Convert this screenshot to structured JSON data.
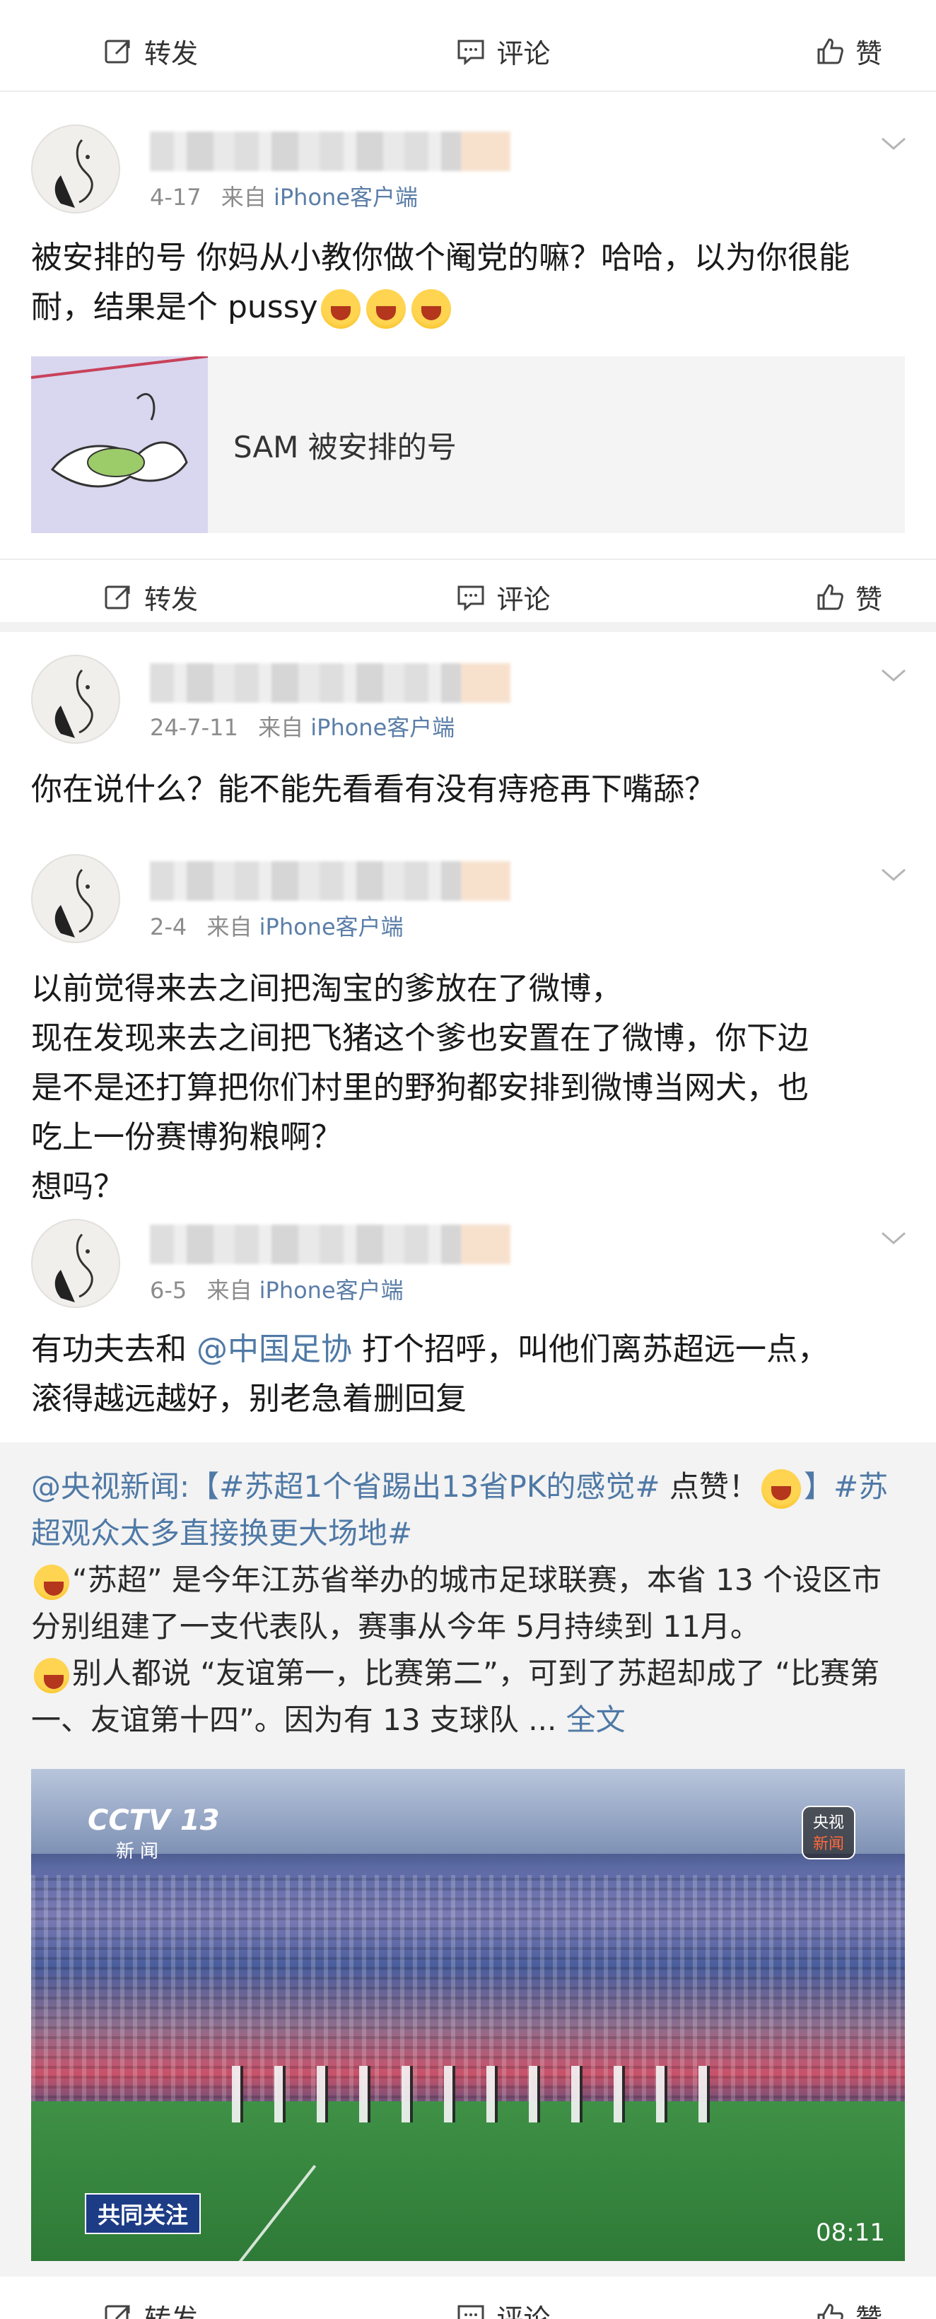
{
  "actions": {
    "repost_label": "转发",
    "comment_label": "评论",
    "like_label": "赞"
  },
  "comments": [
    {
      "date": "4-17",
      "from_prefix": "来自",
      "source": "iPhone客户端",
      "text": "被安排的号 你妈从小教你做个阉党的嘛？哈哈，以为你很能耐，结果是个 pussy",
      "share_card_label": "SAM 被安排的号"
    },
    {
      "date": "24-7-11",
      "from_prefix": "来自",
      "source": "iPhone客户端",
      "text": "你在说什么？能不能先看看有没有痔疮再下嘴舔？"
    },
    {
      "date": "2-4",
      "from_prefix": "来自",
      "source": "iPhone客户端",
      "lines": [
        "以前觉得来去之间把淘宝的爹放在了微博，",
        "现在发现来去之间把飞猪这个爹也安置在了微博，你下边",
        "是不是还打算把你们村里的野狗都安排到微博当网犬，也",
        "吃上一份赛博狗粮啊？",
        "想吗？"
      ]
    },
    {
      "date": "6-5",
      "from_prefix": "来自",
      "source": "iPhone客户端",
      "text_a": "有功夫去和 ",
      "mention": "@中国足协",
      "text_b": " 打个招呼，叫他们离苏超远一点，",
      "text_c": "滚得越远越好，别老急着删回复"
    }
  ],
  "repost": {
    "author": "@央视新闻:",
    "topic1": "【#苏超1个省踢出13省PK的感觉#",
    "text_after_topic1": " 点赞！",
    "topic2": "】#苏超观众太多直接换更大场地#",
    "para1": "“苏超” 是今年江苏省举办的城市足球联赛，本省 13 个设区市分别组建了一支代表队，赛事从今年 5月持续到 11月。",
    "para2": "别人都说 “友谊第一，比赛第二”，可到了苏超却成了 “比赛第一、友谊第十四”。因为有 13 支球队 ...",
    "full_text_link": "全文",
    "video": {
      "channel_logo": "CCTV 13",
      "channel_sub": "新闻",
      "badge_line1": "央视",
      "badge_line2": "新闻",
      "caption": "共同关注",
      "duration": "08:11"
    }
  }
}
